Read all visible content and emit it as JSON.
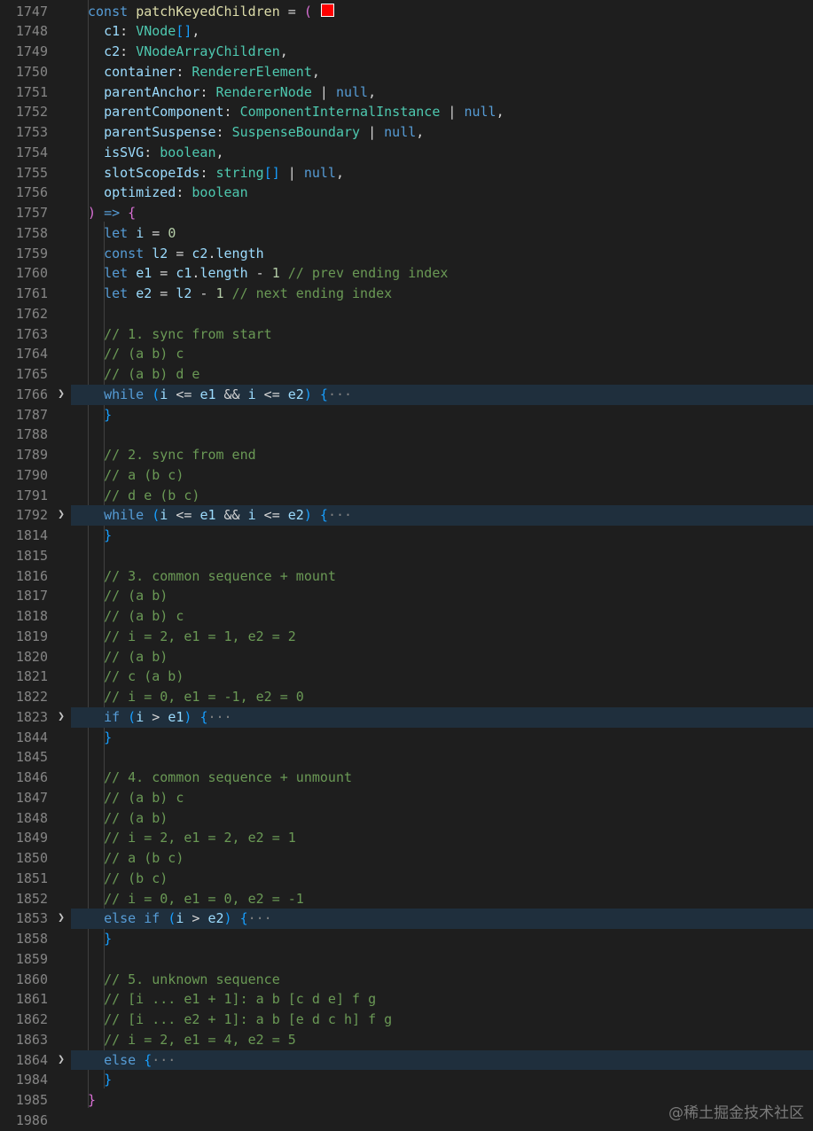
{
  "editor": {
    "lines": [
      {
        "no": "1747",
        "folded": false,
        "code": [
          [
            "k",
            "const "
          ],
          [
            "f",
            "patchKeyedChildren"
          ],
          [
            "d",
            " = "
          ],
          [
            "p1",
            "("
          ],
          [
            "d",
            " "
          ]
        ],
        "marker": true
      },
      {
        "no": "1748",
        "folded": false,
        "code": [
          [
            "d",
            "  "
          ],
          [
            "v",
            "c1"
          ],
          [
            "d",
            ": "
          ],
          [
            "t",
            "VNode"
          ],
          [
            "p2",
            "[]"
          ],
          [
            "d",
            ","
          ]
        ]
      },
      {
        "no": "1749",
        "folded": false,
        "code": [
          [
            "d",
            "  "
          ],
          [
            "v",
            "c2"
          ],
          [
            "d",
            ": "
          ],
          [
            "t",
            "VNodeArrayChildren"
          ],
          [
            "d",
            ","
          ]
        ]
      },
      {
        "no": "1750",
        "folded": false,
        "code": [
          [
            "d",
            "  "
          ],
          [
            "v",
            "container"
          ],
          [
            "d",
            ": "
          ],
          [
            "t",
            "RendererElement"
          ],
          [
            "d",
            ","
          ]
        ]
      },
      {
        "no": "1751",
        "folded": false,
        "code": [
          [
            "d",
            "  "
          ],
          [
            "v",
            "parentAnchor"
          ],
          [
            "d",
            ": "
          ],
          [
            "t",
            "RendererNode"
          ],
          [
            "d",
            " | "
          ],
          [
            "k",
            "null"
          ],
          [
            "d",
            ","
          ]
        ]
      },
      {
        "no": "1752",
        "folded": false,
        "code": [
          [
            "d",
            "  "
          ],
          [
            "v",
            "parentComponent"
          ],
          [
            "d",
            ": "
          ],
          [
            "t",
            "ComponentInternalInstance"
          ],
          [
            "d",
            " | "
          ],
          [
            "k",
            "null"
          ],
          [
            "d",
            ","
          ]
        ]
      },
      {
        "no": "1753",
        "folded": false,
        "code": [
          [
            "d",
            "  "
          ],
          [
            "v",
            "parentSuspense"
          ],
          [
            "d",
            ": "
          ],
          [
            "t",
            "SuspenseBoundary"
          ],
          [
            "d",
            " | "
          ],
          [
            "k",
            "null"
          ],
          [
            "d",
            ","
          ]
        ]
      },
      {
        "no": "1754",
        "folded": false,
        "code": [
          [
            "d",
            "  "
          ],
          [
            "v",
            "isSVG"
          ],
          [
            "d",
            ": "
          ],
          [
            "t",
            "boolean"
          ],
          [
            "d",
            ","
          ]
        ]
      },
      {
        "no": "1755",
        "folded": false,
        "code": [
          [
            "d",
            "  "
          ],
          [
            "v",
            "slotScopeIds"
          ],
          [
            "d",
            ": "
          ],
          [
            "t",
            "string"
          ],
          [
            "p2",
            "[]"
          ],
          [
            "d",
            " | "
          ],
          [
            "k",
            "null"
          ],
          [
            "d",
            ","
          ]
        ]
      },
      {
        "no": "1756",
        "folded": false,
        "code": [
          [
            "d",
            "  "
          ],
          [
            "v",
            "optimized"
          ],
          [
            "d",
            ": "
          ],
          [
            "t",
            "boolean"
          ]
        ]
      },
      {
        "no": "1757",
        "folded": false,
        "code": [
          [
            "p1",
            ")"
          ],
          [
            "d",
            " "
          ],
          [
            "k",
            "=>"
          ],
          [
            "d",
            " "
          ],
          [
            "p1",
            "{"
          ]
        ]
      },
      {
        "no": "1758",
        "folded": false,
        "code": [
          [
            "d",
            "  "
          ],
          [
            "k",
            "let "
          ],
          [
            "v",
            "i"
          ],
          [
            "d",
            " = "
          ],
          [
            "n",
            "0"
          ]
        ]
      },
      {
        "no": "1759",
        "folded": false,
        "code": [
          [
            "d",
            "  "
          ],
          [
            "k",
            "const "
          ],
          [
            "v",
            "l2"
          ],
          [
            "d",
            " = "
          ],
          [
            "v",
            "c2"
          ],
          [
            "d",
            "."
          ],
          [
            "v",
            "length"
          ]
        ]
      },
      {
        "no": "1760",
        "folded": false,
        "code": [
          [
            "d",
            "  "
          ],
          [
            "k",
            "let "
          ],
          [
            "v",
            "e1"
          ],
          [
            "d",
            " = "
          ],
          [
            "v",
            "c1"
          ],
          [
            "d",
            "."
          ],
          [
            "v",
            "length"
          ],
          [
            "d",
            " - "
          ],
          [
            "n",
            "1"
          ],
          [
            "d",
            " "
          ],
          [
            "c",
            "// prev ending index"
          ]
        ]
      },
      {
        "no": "1761",
        "folded": false,
        "code": [
          [
            "d",
            "  "
          ],
          [
            "k",
            "let "
          ],
          [
            "v",
            "e2"
          ],
          [
            "d",
            " = "
          ],
          [
            "v",
            "l2"
          ],
          [
            "d",
            " - "
          ],
          [
            "n",
            "1"
          ],
          [
            "d",
            " "
          ],
          [
            "c",
            "// next ending index"
          ]
        ]
      },
      {
        "no": "1762",
        "folded": false,
        "code": []
      },
      {
        "no": "1763",
        "folded": false,
        "code": [
          [
            "d",
            "  "
          ],
          [
            "c",
            "// 1. sync from start"
          ]
        ]
      },
      {
        "no": "1764",
        "folded": false,
        "code": [
          [
            "d",
            "  "
          ],
          [
            "c",
            "// (a b) c"
          ]
        ]
      },
      {
        "no": "1765",
        "folded": false,
        "code": [
          [
            "d",
            "  "
          ],
          [
            "c",
            "// (a b) d e"
          ]
        ]
      },
      {
        "no": "1766",
        "folded": true,
        "code": [
          [
            "d",
            "  "
          ],
          [
            "k",
            "while"
          ],
          [
            "d",
            " "
          ],
          [
            "p2",
            "("
          ],
          [
            "v",
            "i"
          ],
          [
            "d",
            " <= "
          ],
          [
            "v",
            "e1"
          ],
          [
            "d",
            " && "
          ],
          [
            "v",
            "i"
          ],
          [
            "d",
            " <= "
          ],
          [
            "v",
            "e2"
          ],
          [
            "p2",
            ")"
          ],
          [
            "d",
            " "
          ],
          [
            "p2",
            "{"
          ],
          [
            "e",
            "···"
          ]
        ]
      },
      {
        "no": "1787",
        "folded": false,
        "code": [
          [
            "d",
            "  "
          ],
          [
            "p2",
            "}"
          ]
        ]
      },
      {
        "no": "1788",
        "folded": false,
        "code": []
      },
      {
        "no": "1789",
        "folded": false,
        "code": [
          [
            "d",
            "  "
          ],
          [
            "c",
            "// 2. sync from end"
          ]
        ]
      },
      {
        "no": "1790",
        "folded": false,
        "code": [
          [
            "d",
            "  "
          ],
          [
            "c",
            "// a (b c)"
          ]
        ]
      },
      {
        "no": "1791",
        "folded": false,
        "code": [
          [
            "d",
            "  "
          ],
          [
            "c",
            "// d e (b c)"
          ]
        ]
      },
      {
        "no": "1792",
        "folded": true,
        "code": [
          [
            "d",
            "  "
          ],
          [
            "k",
            "while"
          ],
          [
            "d",
            " "
          ],
          [
            "p2",
            "("
          ],
          [
            "v",
            "i"
          ],
          [
            "d",
            " <= "
          ],
          [
            "v",
            "e1"
          ],
          [
            "d",
            " && "
          ],
          [
            "v",
            "i"
          ],
          [
            "d",
            " <= "
          ],
          [
            "v",
            "e2"
          ],
          [
            "p2",
            ")"
          ],
          [
            "d",
            " "
          ],
          [
            "p2",
            "{"
          ],
          [
            "e",
            "···"
          ]
        ]
      },
      {
        "no": "1814",
        "folded": false,
        "code": [
          [
            "d",
            "  "
          ],
          [
            "p2",
            "}"
          ]
        ]
      },
      {
        "no": "1815",
        "folded": false,
        "code": []
      },
      {
        "no": "1816",
        "folded": false,
        "code": [
          [
            "d",
            "  "
          ],
          [
            "c",
            "// 3. common sequence + mount"
          ]
        ]
      },
      {
        "no": "1817",
        "folded": false,
        "code": [
          [
            "d",
            "  "
          ],
          [
            "c",
            "// (a b)"
          ]
        ]
      },
      {
        "no": "1818",
        "folded": false,
        "code": [
          [
            "d",
            "  "
          ],
          [
            "c",
            "// (a b) c"
          ]
        ]
      },
      {
        "no": "1819",
        "folded": false,
        "code": [
          [
            "d",
            "  "
          ],
          [
            "c",
            "// i = 2, e1 = 1, e2 = 2"
          ]
        ]
      },
      {
        "no": "1820",
        "folded": false,
        "code": [
          [
            "d",
            "  "
          ],
          [
            "c",
            "// (a b)"
          ]
        ]
      },
      {
        "no": "1821",
        "folded": false,
        "code": [
          [
            "d",
            "  "
          ],
          [
            "c",
            "// c (a b)"
          ]
        ]
      },
      {
        "no": "1822",
        "folded": false,
        "code": [
          [
            "d",
            "  "
          ],
          [
            "c",
            "// i = 0, e1 = -1, e2 = 0"
          ]
        ]
      },
      {
        "no": "1823",
        "folded": true,
        "code": [
          [
            "d",
            "  "
          ],
          [
            "k",
            "if"
          ],
          [
            "d",
            " "
          ],
          [
            "p2",
            "("
          ],
          [
            "v",
            "i"
          ],
          [
            "d",
            " > "
          ],
          [
            "v",
            "e1"
          ],
          [
            "p2",
            ")"
          ],
          [
            "d",
            " "
          ],
          [
            "p2",
            "{"
          ],
          [
            "e",
            "···"
          ]
        ]
      },
      {
        "no": "1844",
        "folded": false,
        "code": [
          [
            "d",
            "  "
          ],
          [
            "p2",
            "}"
          ]
        ]
      },
      {
        "no": "1845",
        "folded": false,
        "code": []
      },
      {
        "no": "1846",
        "folded": false,
        "code": [
          [
            "d",
            "  "
          ],
          [
            "c",
            "// 4. common sequence + unmount"
          ]
        ]
      },
      {
        "no": "1847",
        "folded": false,
        "code": [
          [
            "d",
            "  "
          ],
          [
            "c",
            "// (a b) c"
          ]
        ]
      },
      {
        "no": "1848",
        "folded": false,
        "code": [
          [
            "d",
            "  "
          ],
          [
            "c",
            "// (a b)"
          ]
        ]
      },
      {
        "no": "1849",
        "folded": false,
        "code": [
          [
            "d",
            "  "
          ],
          [
            "c",
            "// i = 2, e1 = 2, e2 = 1"
          ]
        ]
      },
      {
        "no": "1850",
        "folded": false,
        "code": [
          [
            "d",
            "  "
          ],
          [
            "c",
            "// a (b c)"
          ]
        ]
      },
      {
        "no": "1851",
        "folded": false,
        "code": [
          [
            "d",
            "  "
          ],
          [
            "c",
            "// (b c)"
          ]
        ]
      },
      {
        "no": "1852",
        "folded": false,
        "code": [
          [
            "d",
            "  "
          ],
          [
            "c",
            "// i = 0, e1 = 0, e2 = -1"
          ]
        ]
      },
      {
        "no": "1853",
        "folded": true,
        "code": [
          [
            "d",
            "  "
          ],
          [
            "k",
            "else if"
          ],
          [
            "d",
            " "
          ],
          [
            "p2",
            "("
          ],
          [
            "v",
            "i"
          ],
          [
            "d",
            " > "
          ],
          [
            "v",
            "e2"
          ],
          [
            "p2",
            ")"
          ],
          [
            "d",
            " "
          ],
          [
            "p2",
            "{"
          ],
          [
            "e",
            "···"
          ]
        ]
      },
      {
        "no": "1858",
        "folded": false,
        "code": [
          [
            "d",
            "  "
          ],
          [
            "p2",
            "}"
          ]
        ]
      },
      {
        "no": "1859",
        "folded": false,
        "code": []
      },
      {
        "no": "1860",
        "folded": false,
        "code": [
          [
            "d",
            "  "
          ],
          [
            "c",
            "// 5. unknown sequence"
          ]
        ]
      },
      {
        "no": "1861",
        "folded": false,
        "code": [
          [
            "d",
            "  "
          ],
          [
            "c",
            "// [i ... e1 + 1]: a b [c d e] f g"
          ]
        ]
      },
      {
        "no": "1862",
        "folded": false,
        "code": [
          [
            "d",
            "  "
          ],
          [
            "c",
            "// [i ... e2 + 1]: a b [e d c h] f g"
          ]
        ]
      },
      {
        "no": "1863",
        "folded": false,
        "code": [
          [
            "d",
            "  "
          ],
          [
            "c",
            "// i = 2, e1 = 4, e2 = 5"
          ]
        ]
      },
      {
        "no": "1864",
        "folded": true,
        "code": [
          [
            "d",
            "  "
          ],
          [
            "k",
            "else"
          ],
          [
            "d",
            " "
          ],
          [
            "p2",
            "{"
          ],
          [
            "e",
            "···"
          ]
        ]
      },
      {
        "no": "1984",
        "folded": false,
        "code": [
          [
            "d",
            "  "
          ],
          [
            "p2",
            "}"
          ]
        ]
      },
      {
        "no": "1985",
        "folded": false,
        "code": [
          [
            "p1",
            "}"
          ]
        ]
      },
      {
        "no": "1986",
        "folded": false,
        "code": []
      }
    ]
  },
  "icons": {
    "fold": "chevron-right-icon"
  },
  "watermark": "@稀土掘金技术社区",
  "colors": {
    "background": "#1e1e1e",
    "line_number": "#858585",
    "keyword": "#569cd6",
    "comment": "#6a9955",
    "type": "#4ec9b0",
    "variable": "#9cdcfe",
    "number": "#b5cea8",
    "function": "#dcdcaa",
    "folded_highlight": "#1f2f3d",
    "marker": "#ff0000"
  }
}
